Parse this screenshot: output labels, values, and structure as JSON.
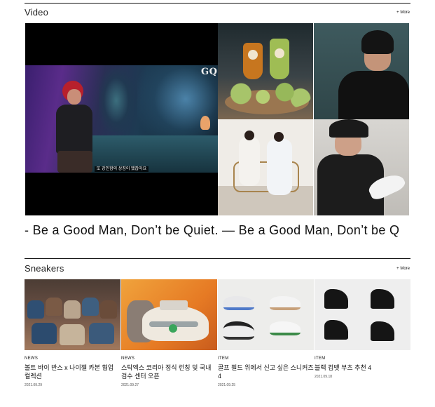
{
  "video": {
    "section_title": "Video",
    "more_label": "More",
    "main": {
      "brand_logo_text": "GQ",
      "subtitle": "또 강인함의 상징이 됐잖아요"
    },
    "marquee_text": "- Be a Good Man, Don’t be Quiet. — Be a Good Man, Don’t be Q"
  },
  "sneakers": {
    "section_title": "Sneakers",
    "more_label": "More",
    "cards": [
      {
        "category": "NEWS",
        "title": "볼트 바이 반스 x 나이젤 카본 협업 컬렉션",
        "date": "2021.09.29"
      },
      {
        "category": "NEWS",
        "title": "스탁엑스 코리아 정식 런칭 및 국내 검수 센터 오픈",
        "date": "2021.09.27"
      },
      {
        "category": "ITEM",
        "title": "골프 필드 위에서 신고 싶은 스니커즈 4",
        "date": "2021.09.25"
      },
      {
        "category": "ITEM",
        "title": "블랙 컴뱃 부츠 추천 4",
        "date": "2021.09.18"
      }
    ]
  },
  "colors": {
    "text": "#111111",
    "background": "#ffffff",
    "rule": "#111111"
  }
}
